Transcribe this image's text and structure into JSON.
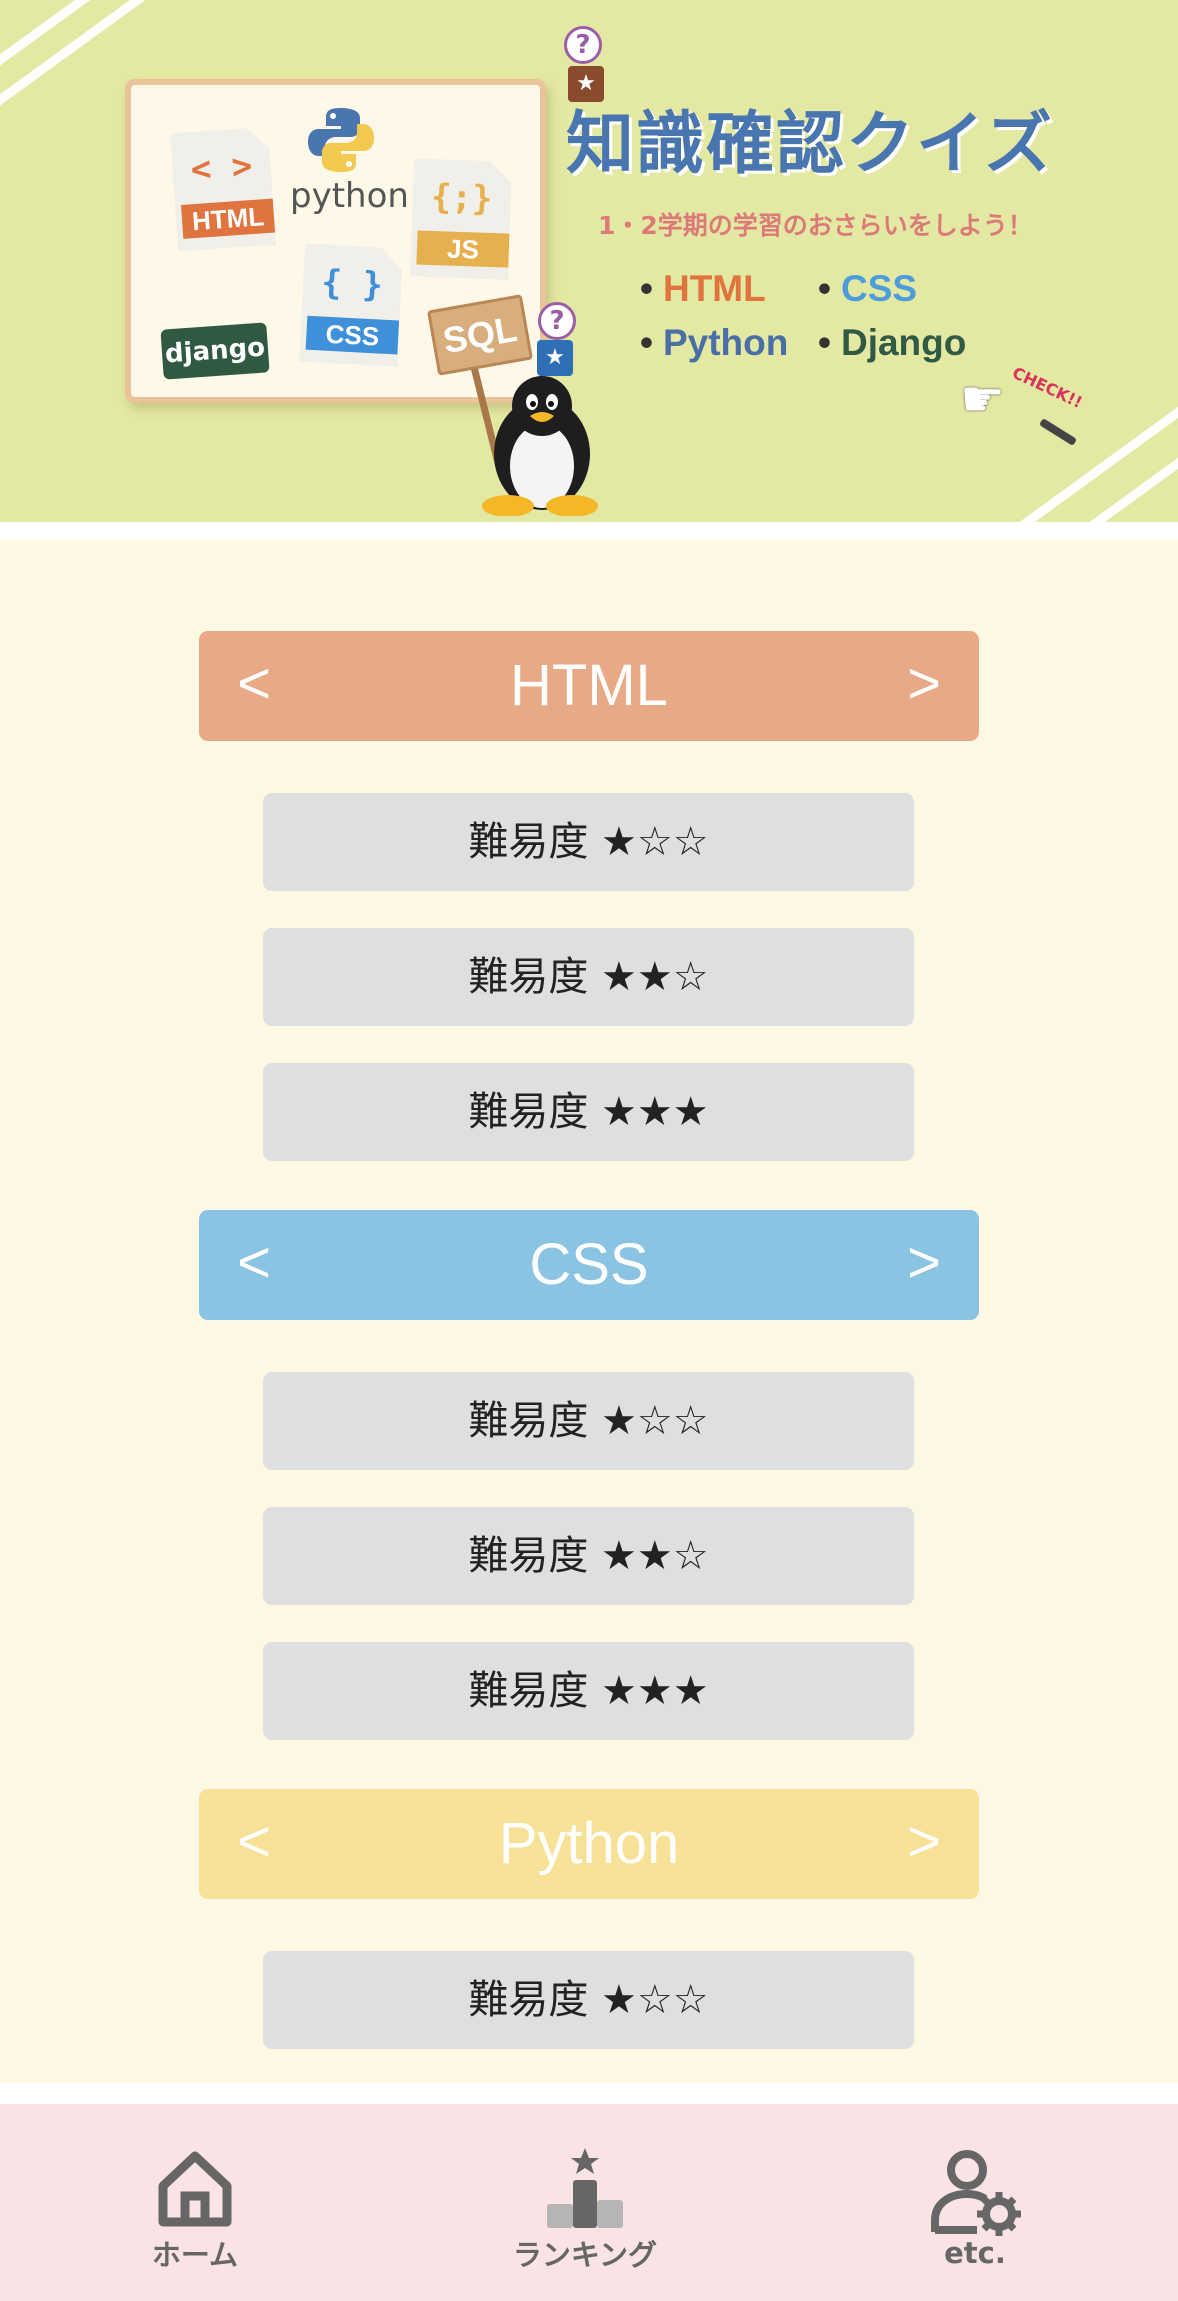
{
  "banner": {
    "title": "知識確認クイズ",
    "subtitle": "1・2学期の学習のおさらいをしよう！",
    "topics": [
      {
        "label": "HTML",
        "color": "#e0743f"
      },
      {
        "label": "CSS",
        "color": "#4d9ddc"
      },
      {
        "label": "Python",
        "color": "#4a6ea6"
      },
      {
        "label": "Django",
        "color": "#315a45"
      }
    ],
    "bullet": "•",
    "illustration": {
      "html_tag": "HTML",
      "html_glyph": "< >",
      "python_word": "python",
      "js_tag": "JS",
      "js_glyph": "{;}",
      "css_tag": "CSS",
      "css_glyph": "{ }",
      "django": "django",
      "sql": "SQL",
      "question_mark": "?",
      "check": "CHECK!!"
    }
  },
  "categories": [
    {
      "name": "HTML",
      "color": "#e8aa86",
      "prev": "<",
      "next": ">",
      "levels": [
        "難易度 ★☆☆",
        "難易度 ★★☆",
        "難易度 ★★★"
      ]
    },
    {
      "name": "CSS",
      "color": "#8bc3e3",
      "prev": "<",
      "next": ">",
      "levels": [
        "難易度 ★☆☆",
        "難易度 ★★☆",
        "難易度 ★★★"
      ]
    },
    {
      "name": "Python",
      "color": "#f7e196",
      "prev": "<",
      "next": ">",
      "levels": [
        "難易度 ★☆☆"
      ]
    }
  ],
  "nav": {
    "home": "ホーム",
    "ranking": "ランキング",
    "etc": "etc."
  }
}
